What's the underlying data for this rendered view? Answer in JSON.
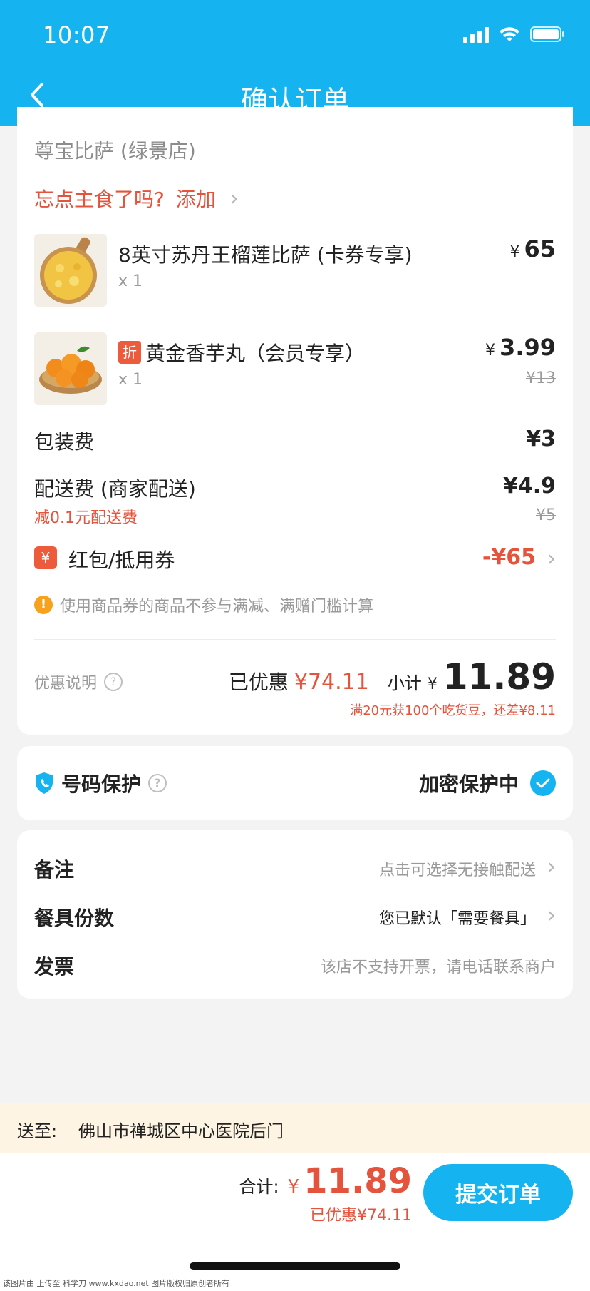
{
  "status_bar": {
    "time": "10:07"
  },
  "nav": {
    "title": "确认订单"
  },
  "shop": {
    "name": "尊宝比萨 (绿景店)",
    "remind_text": "忘点主食了吗?",
    "remind_action": "添加"
  },
  "items": [
    {
      "name": "8英寸苏丹王榴莲比萨 (卡券专享)",
      "qty": "x 1",
      "currency": "¥",
      "price": "65",
      "original_price": "",
      "tag": ""
    },
    {
      "name": "黄金香芋丸（会员专享）",
      "qty": "x 1",
      "currency": "¥",
      "price": "3.99",
      "original_price": "¥13",
      "tag": "折"
    }
  ],
  "fees": {
    "packaging_label": "包装费",
    "packaging_value": "¥3",
    "delivery_label": "配送费 (商家配送)",
    "delivery_value": "¥4.9",
    "delivery_discount": "减0.1元配送费",
    "delivery_original": "¥5"
  },
  "coupon": {
    "icon_text": "¥",
    "label": "红包/抵用券",
    "value": "-¥65"
  },
  "notice": {
    "icon_text": "!",
    "text": "使用商品券的商品不参与满减、满赠门槛计算"
  },
  "summary": {
    "discount_explain": "优惠说明",
    "saved_label": "已优惠",
    "saved_value": "¥74.11",
    "subtotal_label": "小计",
    "subtotal_currency": "¥",
    "subtotal_value": "11.89",
    "bonus_text": "满20元获100个吃货豆，还差¥8.11"
  },
  "phone_protect": {
    "label": "号码保护",
    "status": "加密保护中"
  },
  "options": {
    "remark_label": "备注",
    "remark_value": "点击可选择无接触配送",
    "utensils_label": "餐具份数",
    "utensils_value": "您已默认「需要餐具」",
    "invoice_label": "发票",
    "invoice_value": "该店不支持开票，请电话联系商户"
  },
  "address": {
    "label": "送至:",
    "value": "佛山市禅城区中心医院后门"
  },
  "bottom": {
    "total_label": "合计:",
    "total_currency": "¥",
    "total_value": "11.89",
    "saved_text": "已优惠¥74.11",
    "submit_label": "提交订单"
  },
  "watermark": "该图片由 上传至 科学刀 www.kxdao.net 图片版权归原创者所有",
  "colors": {
    "primary": "#15b4f1",
    "accent_red": "#e5533c",
    "warning": "#f7a21c",
    "address_bg": "#fdf4e3"
  }
}
